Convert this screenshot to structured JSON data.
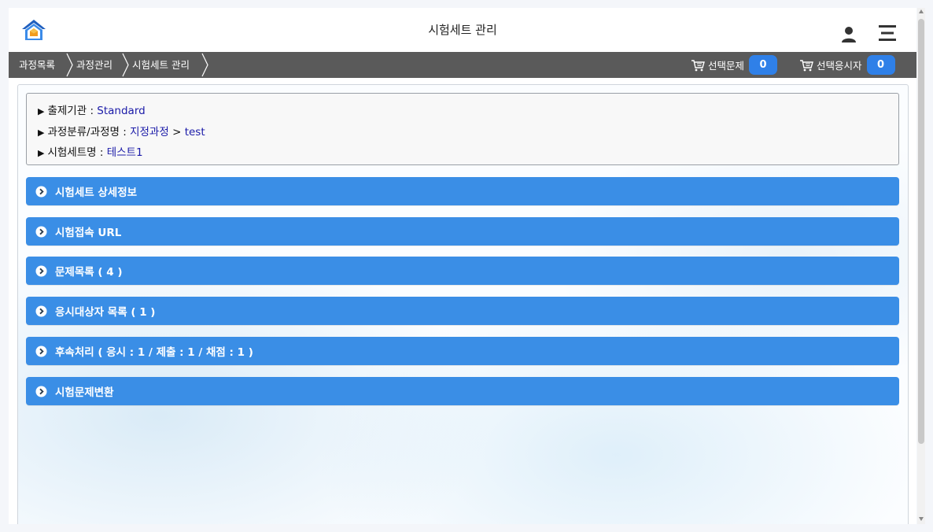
{
  "header": {
    "title": "시험세트 관리"
  },
  "breadcrumb": {
    "items": [
      "과정목록",
      "과정관리",
      "시험세트 관리"
    ]
  },
  "carts": {
    "selected_questions_label": "선택문제",
    "selected_questions_count": "0",
    "selected_examinees_label": "선택응시자",
    "selected_examinees_count": "0"
  },
  "info": {
    "institution_label": "출제기관 : ",
    "institution_value": "Standard",
    "course_label": "과정분류/과정명 : ",
    "course_category": "지정과정",
    "course_sep": " > ",
    "course_name": "test",
    "exam_set_label": "시험세트명 : ",
    "exam_set_value": "테스트1",
    "marker": "▶"
  },
  "sections": [
    {
      "label": "시험세트 상세정보"
    },
    {
      "label": "시험접속 URL"
    },
    {
      "label": "문제목록 ( 4 )"
    },
    {
      "label": "응시대상자 목록 ( 1 )"
    },
    {
      "label": "후속처리 ( 응시 : 1 / 제출 : 1 / 채점 : 1 )"
    },
    {
      "label": "시험문제변환"
    }
  ],
  "colors": {
    "section_bg": "#3a8ee6",
    "navbar_bg": "#5a5a5a",
    "badge_bg": "#2f80e8",
    "link_value": "#1a1aa8"
  },
  "icons": {
    "home": "home-icon",
    "user": "user-icon",
    "menu": "hamburger-menu-icon",
    "cart": "cart-icon",
    "section": "chevron-right-circle-icon"
  }
}
